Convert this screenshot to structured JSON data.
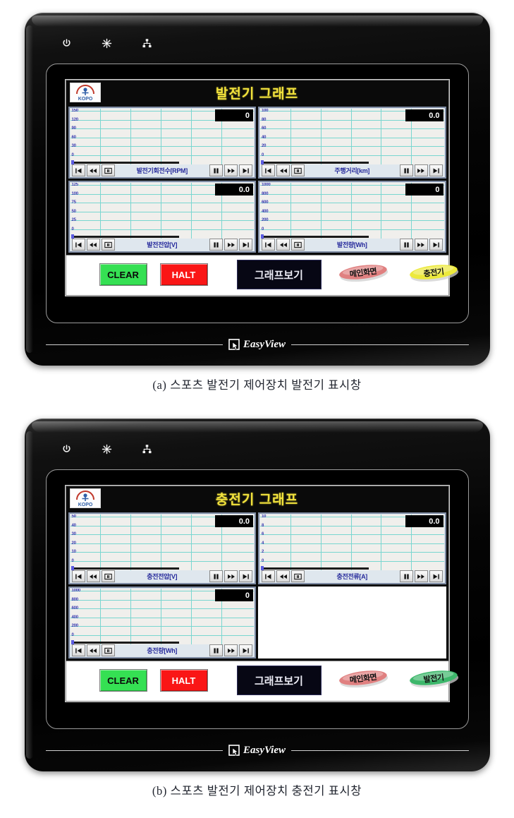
{
  "figures": [
    {
      "id": "a",
      "caption": "(a) 스포츠 발전기 제어장치 발전기 표시창",
      "device": {
        "status_icons": [
          "power-icon",
          "brightness-icon",
          "network-icon"
        ],
        "app_title": "발전기 그래프",
        "logo_text": "KOPO",
        "trends": [
          {
            "label": "발전기회전수[RPM]",
            "value": "0",
            "yticks": [
              "150",
              "120",
              "90",
              "60",
              "30",
              "0"
            ],
            "ymax": 150,
            "bar_start_label": "jump-first",
            "buttons_left": [
              "skip-back-icon",
              "rewind-icon",
              "stop-icon"
            ],
            "buttons_right": [
              "pause-icon",
              "fast-forward-icon",
              "skip-forward-icon"
            ]
          },
          {
            "label": "주행거리[km]",
            "value": "0.0",
            "yticks": [
              "100",
              "80",
              "60",
              "40",
              "20",
              "0"
            ],
            "ymax": 100,
            "buttons_left": [
              "skip-back-icon",
              "rewind-icon",
              "stop-icon"
            ],
            "buttons_right": [
              "pause-icon",
              "fast-forward-icon",
              "skip-forward-icon"
            ]
          },
          {
            "label": "발전전압[V]",
            "value": "0.0",
            "yticks": [
              "125",
              "100",
              "75",
              "50",
              "25",
              "0"
            ],
            "ymax": 125,
            "buttons_left": [
              "skip-back-icon",
              "rewind-icon",
              "stop-icon"
            ],
            "buttons_right": [
              "pause-icon",
              "fast-forward-icon",
              "skip-forward-icon"
            ]
          },
          {
            "label": "발전량[Wh]",
            "value": "0",
            "yticks": [
              "1000",
              "800",
              "600",
              "400",
              "200",
              "0"
            ],
            "ymax": 1000,
            "buttons_left": [
              "skip-back-icon",
              "rewind-icon",
              "stop-icon"
            ],
            "buttons_right": [
              "pause-icon",
              "fast-forward-icon",
              "skip-forward-icon"
            ]
          }
        ],
        "buttons": {
          "clear": "CLEAR",
          "halt": "HALT",
          "graph_view": "그래프보기",
          "pill_main": "메인화면",
          "pill_alt": "충전기",
          "pill_main_color": "#e08080",
          "pill_alt_color": "#ece93c"
        },
        "brand": "EasyView"
      },
      "chart_data": [
        {
          "type": "line",
          "title": "발전기회전수[RPM]",
          "ylabel": "RPM",
          "ylim": [
            0,
            150
          ],
          "yticks": [
            0,
            30,
            60,
            90,
            120,
            150
          ],
          "series": [
            {
              "name": "발전기회전수",
              "values": []
            }
          ],
          "current_value": 0,
          "grid": true
        },
        {
          "type": "line",
          "title": "주행거리[km]",
          "ylabel": "km",
          "ylim": [
            0,
            100
          ],
          "yticks": [
            0,
            20,
            40,
            60,
            80,
            100
          ],
          "series": [
            {
              "name": "주행거리",
              "values": []
            }
          ],
          "current_value": 0.0,
          "grid": true
        },
        {
          "type": "line",
          "title": "발전전압[V]",
          "ylabel": "V",
          "ylim": [
            0,
            125
          ],
          "yticks": [
            0,
            25,
            50,
            75,
            100,
            125
          ],
          "series": [
            {
              "name": "발전전압",
              "values": []
            }
          ],
          "current_value": 0.0,
          "grid": true
        },
        {
          "type": "line",
          "title": "발전량[Wh]",
          "ylabel": "Wh",
          "ylim": [
            0,
            1000
          ],
          "yticks": [
            0,
            200,
            400,
            600,
            800,
            1000
          ],
          "series": [
            {
              "name": "발전량",
              "values": []
            }
          ],
          "current_value": 0,
          "grid": true
        }
      ]
    },
    {
      "id": "b",
      "caption": "(b) 스포츠 발전기 제어장치 충전기 표시창",
      "device": {
        "status_icons": [
          "power-icon",
          "brightness-icon",
          "network-icon"
        ],
        "app_title": "충전기 그래프",
        "logo_text": "KOPO",
        "trends": [
          {
            "label": "충전전압[V]",
            "value": "0.0",
            "yticks": [
              "50",
              "40",
              "30",
              "20",
              "10",
              "0"
            ],
            "ymax": 50,
            "buttons_left": [
              "skip-back-icon",
              "rewind-icon",
              "stop-icon"
            ],
            "buttons_right": [
              "pause-icon",
              "fast-forward-icon",
              "skip-forward-icon"
            ]
          },
          {
            "label": "충전전류[A]",
            "value": "0.0",
            "yticks": [
              "10",
              "8",
              "6",
              "4",
              "2",
              "0"
            ],
            "ymax": 10,
            "buttons_left": [
              "skip-back-icon",
              "rewind-icon",
              "stop-icon"
            ],
            "buttons_right": [
              "pause-icon",
              "fast-forward-icon",
              "skip-forward-icon"
            ]
          },
          {
            "label": "충전량[Wh]",
            "value": "0",
            "yticks": [
              "1000",
              "800",
              "600",
              "400",
              "200",
              "0"
            ],
            "ymax": 1000,
            "buttons_left": [
              "skip-back-icon",
              "rewind-icon",
              "stop-icon"
            ],
            "buttons_right": [
              "pause-icon",
              "fast-forward-icon",
              "skip-forward-icon"
            ]
          }
        ],
        "buttons": {
          "clear": "CLEAR",
          "halt": "HALT",
          "graph_view": "그래프보기",
          "pill_main": "메인화면",
          "pill_alt": "발전기",
          "pill_main_color": "#e08080",
          "pill_alt_color": "#3db76b"
        },
        "brand": "EasyView"
      },
      "chart_data": [
        {
          "type": "line",
          "title": "충전전압[V]",
          "ylabel": "V",
          "ylim": [
            0,
            50
          ],
          "yticks": [
            0,
            10,
            20,
            30,
            40,
            50
          ],
          "series": [
            {
              "name": "충전전압",
              "values": []
            }
          ],
          "current_value": 0.0,
          "grid": true
        },
        {
          "type": "line",
          "title": "충전전류[A]",
          "ylabel": "A",
          "ylim": [
            0,
            10
          ],
          "yticks": [
            0,
            2,
            4,
            6,
            8,
            10
          ],
          "series": [
            {
              "name": "충전전류",
              "values": []
            }
          ],
          "current_value": 0.0,
          "grid": true
        },
        {
          "type": "line",
          "title": "충전량[Wh]",
          "ylabel": "Wh",
          "ylim": [
            0,
            1000
          ],
          "yticks": [
            0,
            200,
            400,
            600,
            800,
            1000
          ],
          "series": [
            {
              "name": "충전량",
              "values": []
            }
          ],
          "current_value": 0,
          "grid": true
        }
      ]
    }
  ]
}
